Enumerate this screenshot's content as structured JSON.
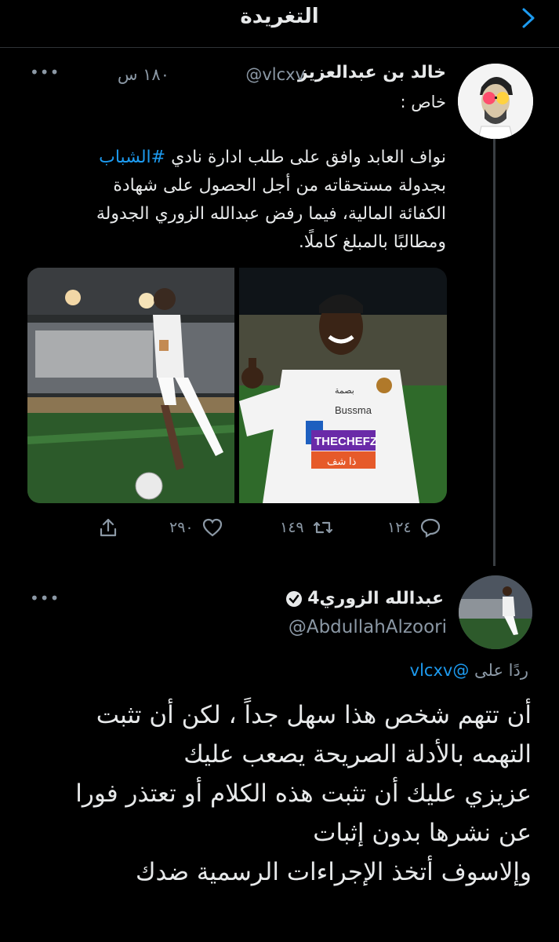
{
  "header": {
    "title": "التغريدة"
  },
  "tweet1": {
    "author_name": "خالد بن عبدالعزيز",
    "handle": "@vlcxv",
    "time": "١٨٠ س",
    "subtitle": "خاص :",
    "body_lines": [
      [
        "نواف العابد وافق على طلب ادارة نادي ",
        "#الشباب"
      ],
      [
        "بجدولة مستحقاته من أجل الحصول على شهادة",
        ""
      ],
      [
        "الكفائة المالية، فيما رفض عبدالله الزوري الجدولة",
        ""
      ],
      [
        "ومطالبًا بالمبلغ كاملًا.",
        ""
      ]
    ],
    "counts": {
      "replies": "١٢٤",
      "retweets": "١٤٩",
      "likes": "٢٩٠"
    },
    "media": {
      "left": {
        "jersey_text": "Bussma",
        "sponsor": "THECHEFZ",
        "sponsor_ar": "ذا شف",
        "brand_ar": "بصمة"
      }
    }
  },
  "tweet2": {
    "author_name": "عبدالله الزوري4",
    "handle": "@AbdullahAlzoori",
    "replying_label": "ردًا على",
    "replying_to": "@vlcxv",
    "body_lines": [
      "أن تتهم شخص هذا سهل جداً ، لكن أن تثبت",
      "التهمه بالأدلة الصريحة يصعب عليك",
      "عزيزي عليك أن تثبت هذه الكلام أو تعتذر فورا",
      "عن نشرها بدون إثبات",
      "وإلاسوف أتخذ الإجراءات الرسمية ضدك"
    ]
  },
  "colors": {
    "accent": "#1d9bf0",
    "muted": "#8b98a5",
    "background": "#000000"
  }
}
